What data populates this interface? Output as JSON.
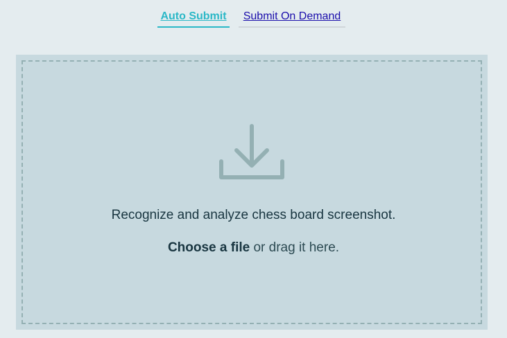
{
  "tabs": [
    {
      "label": "Auto Submit",
      "active": true
    },
    {
      "label": "Submit On Demand",
      "active": false
    }
  ],
  "dropzone": {
    "icon": "download-icon",
    "title": "Recognize and analyze chess board screenshot.",
    "choose_label": "Choose a file",
    "drag_text": " or drag it here."
  },
  "colors": {
    "background": "#e4ecef",
    "active_tab": "#2bb8c7",
    "link": "#1a0dab",
    "dropzone": "#c7d9df",
    "dashed_border": "#94b0b3",
    "icon": "#94b0b3",
    "text": "#183540"
  }
}
